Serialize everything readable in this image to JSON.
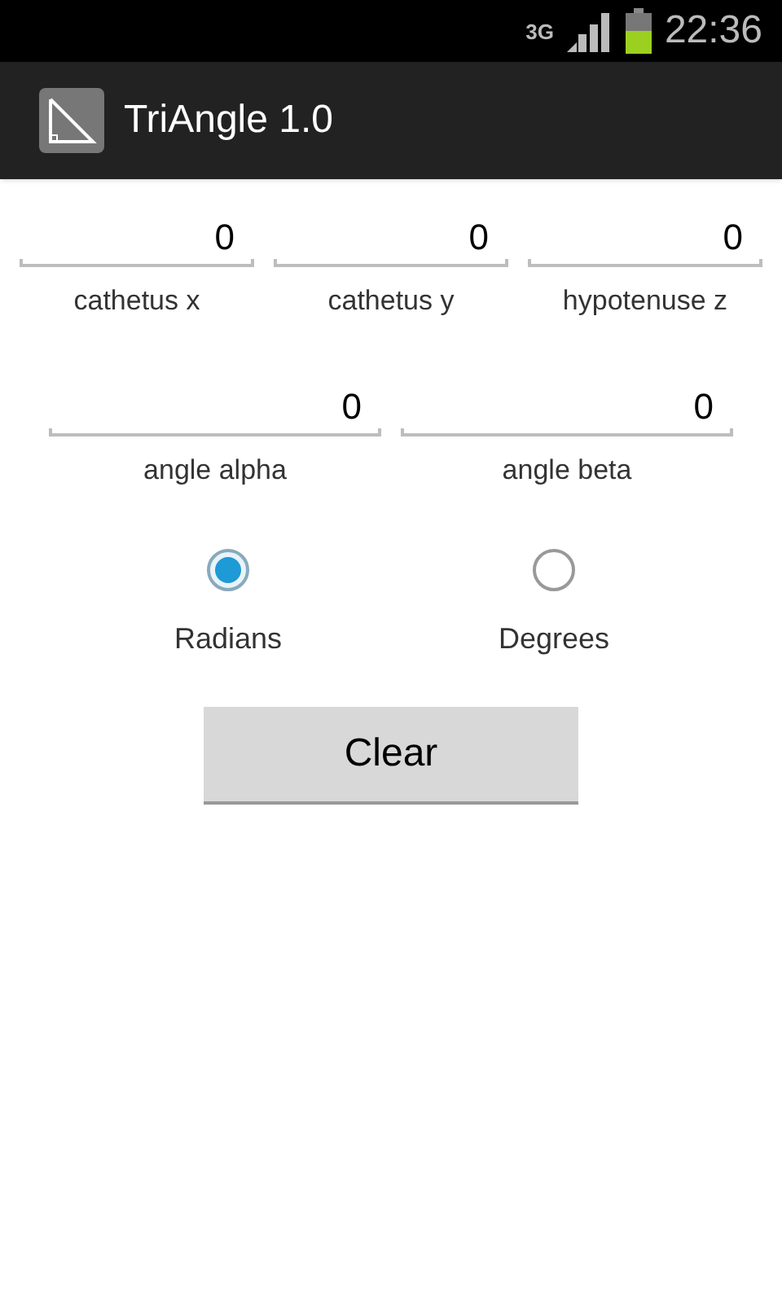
{
  "status_bar": {
    "network": "3G",
    "time": "22:36"
  },
  "action_bar": {
    "title": "TriAngle 1.0"
  },
  "sides": [
    {
      "value": "0",
      "label": "cathetus x"
    },
    {
      "value": "0",
      "label": "cathetus y"
    },
    {
      "value": "0",
      "label": "hypotenuse z"
    }
  ],
  "angles": [
    {
      "value": "0",
      "label": "angle alpha"
    },
    {
      "value": "0",
      "label": "angle beta"
    }
  ],
  "units": [
    {
      "label": "Radians",
      "selected": true
    },
    {
      "label": "Degrees",
      "selected": false
    }
  ],
  "clear_button": "Clear"
}
